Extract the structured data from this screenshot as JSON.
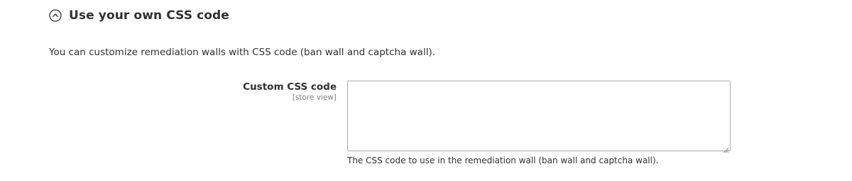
{
  "section": {
    "title": "Use your own CSS code",
    "icon": "chevron-up-circle-icon",
    "description": "You can customize remediation walls with CSS code (ban wall and captcha wall)."
  },
  "field": {
    "label": "Custom CSS code",
    "scope": "[store view]",
    "value": "",
    "placeholder": "",
    "note": "The CSS code to use in the remediation wall (ban wall and captcha wall)."
  },
  "colors": {
    "text": "#303030",
    "muted": "#808080",
    "border": "#adadad"
  }
}
